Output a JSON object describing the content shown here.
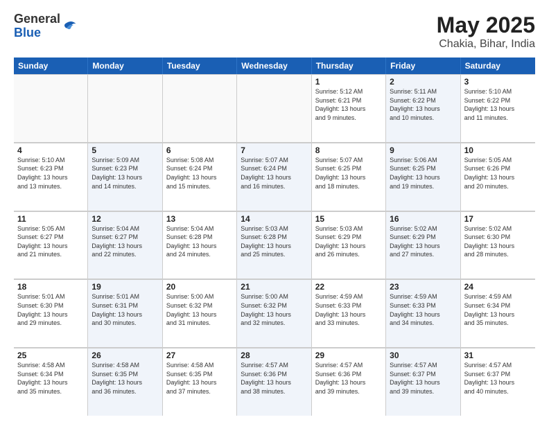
{
  "logo": {
    "general": "General",
    "blue": "Blue"
  },
  "title": "May 2025",
  "subtitle": "Chakia, Bihar, India",
  "header_days": [
    "Sunday",
    "Monday",
    "Tuesday",
    "Wednesday",
    "Thursday",
    "Friday",
    "Saturday"
  ],
  "weeks": [
    [
      {
        "day": "",
        "info": "",
        "shaded": false,
        "empty": true
      },
      {
        "day": "",
        "info": "",
        "shaded": false,
        "empty": true
      },
      {
        "day": "",
        "info": "",
        "shaded": false,
        "empty": true
      },
      {
        "day": "",
        "info": "",
        "shaded": false,
        "empty": true
      },
      {
        "day": "1",
        "info": "Sunrise: 5:12 AM\nSunset: 6:21 PM\nDaylight: 13 hours\nand 9 minutes.",
        "shaded": false,
        "empty": false
      },
      {
        "day": "2",
        "info": "Sunrise: 5:11 AM\nSunset: 6:22 PM\nDaylight: 13 hours\nand 10 minutes.",
        "shaded": true,
        "empty": false
      },
      {
        "day": "3",
        "info": "Sunrise: 5:10 AM\nSunset: 6:22 PM\nDaylight: 13 hours\nand 11 minutes.",
        "shaded": false,
        "empty": false
      }
    ],
    [
      {
        "day": "4",
        "info": "Sunrise: 5:10 AM\nSunset: 6:23 PM\nDaylight: 13 hours\nand 13 minutes.",
        "shaded": false,
        "empty": false
      },
      {
        "day": "5",
        "info": "Sunrise: 5:09 AM\nSunset: 6:23 PM\nDaylight: 13 hours\nand 14 minutes.",
        "shaded": true,
        "empty": false
      },
      {
        "day": "6",
        "info": "Sunrise: 5:08 AM\nSunset: 6:24 PM\nDaylight: 13 hours\nand 15 minutes.",
        "shaded": false,
        "empty": false
      },
      {
        "day": "7",
        "info": "Sunrise: 5:07 AM\nSunset: 6:24 PM\nDaylight: 13 hours\nand 16 minutes.",
        "shaded": true,
        "empty": false
      },
      {
        "day": "8",
        "info": "Sunrise: 5:07 AM\nSunset: 6:25 PM\nDaylight: 13 hours\nand 18 minutes.",
        "shaded": false,
        "empty": false
      },
      {
        "day": "9",
        "info": "Sunrise: 5:06 AM\nSunset: 6:25 PM\nDaylight: 13 hours\nand 19 minutes.",
        "shaded": true,
        "empty": false
      },
      {
        "day": "10",
        "info": "Sunrise: 5:05 AM\nSunset: 6:26 PM\nDaylight: 13 hours\nand 20 minutes.",
        "shaded": false,
        "empty": false
      }
    ],
    [
      {
        "day": "11",
        "info": "Sunrise: 5:05 AM\nSunset: 6:27 PM\nDaylight: 13 hours\nand 21 minutes.",
        "shaded": false,
        "empty": false
      },
      {
        "day": "12",
        "info": "Sunrise: 5:04 AM\nSunset: 6:27 PM\nDaylight: 13 hours\nand 22 minutes.",
        "shaded": true,
        "empty": false
      },
      {
        "day": "13",
        "info": "Sunrise: 5:04 AM\nSunset: 6:28 PM\nDaylight: 13 hours\nand 24 minutes.",
        "shaded": false,
        "empty": false
      },
      {
        "day": "14",
        "info": "Sunrise: 5:03 AM\nSunset: 6:28 PM\nDaylight: 13 hours\nand 25 minutes.",
        "shaded": true,
        "empty": false
      },
      {
        "day": "15",
        "info": "Sunrise: 5:03 AM\nSunset: 6:29 PM\nDaylight: 13 hours\nand 26 minutes.",
        "shaded": false,
        "empty": false
      },
      {
        "day": "16",
        "info": "Sunrise: 5:02 AM\nSunset: 6:29 PM\nDaylight: 13 hours\nand 27 minutes.",
        "shaded": true,
        "empty": false
      },
      {
        "day": "17",
        "info": "Sunrise: 5:02 AM\nSunset: 6:30 PM\nDaylight: 13 hours\nand 28 minutes.",
        "shaded": false,
        "empty": false
      }
    ],
    [
      {
        "day": "18",
        "info": "Sunrise: 5:01 AM\nSunset: 6:30 PM\nDaylight: 13 hours\nand 29 minutes.",
        "shaded": false,
        "empty": false
      },
      {
        "day": "19",
        "info": "Sunrise: 5:01 AM\nSunset: 6:31 PM\nDaylight: 13 hours\nand 30 minutes.",
        "shaded": true,
        "empty": false
      },
      {
        "day": "20",
        "info": "Sunrise: 5:00 AM\nSunset: 6:32 PM\nDaylight: 13 hours\nand 31 minutes.",
        "shaded": false,
        "empty": false
      },
      {
        "day": "21",
        "info": "Sunrise: 5:00 AM\nSunset: 6:32 PM\nDaylight: 13 hours\nand 32 minutes.",
        "shaded": true,
        "empty": false
      },
      {
        "day": "22",
        "info": "Sunrise: 4:59 AM\nSunset: 6:33 PM\nDaylight: 13 hours\nand 33 minutes.",
        "shaded": false,
        "empty": false
      },
      {
        "day": "23",
        "info": "Sunrise: 4:59 AM\nSunset: 6:33 PM\nDaylight: 13 hours\nand 34 minutes.",
        "shaded": true,
        "empty": false
      },
      {
        "day": "24",
        "info": "Sunrise: 4:59 AM\nSunset: 6:34 PM\nDaylight: 13 hours\nand 35 minutes.",
        "shaded": false,
        "empty": false
      }
    ],
    [
      {
        "day": "25",
        "info": "Sunrise: 4:58 AM\nSunset: 6:34 PM\nDaylight: 13 hours\nand 35 minutes.",
        "shaded": false,
        "empty": false
      },
      {
        "day": "26",
        "info": "Sunrise: 4:58 AM\nSunset: 6:35 PM\nDaylight: 13 hours\nand 36 minutes.",
        "shaded": true,
        "empty": false
      },
      {
        "day": "27",
        "info": "Sunrise: 4:58 AM\nSunset: 6:35 PM\nDaylight: 13 hours\nand 37 minutes.",
        "shaded": false,
        "empty": false
      },
      {
        "day": "28",
        "info": "Sunrise: 4:57 AM\nSunset: 6:36 PM\nDaylight: 13 hours\nand 38 minutes.",
        "shaded": true,
        "empty": false
      },
      {
        "day": "29",
        "info": "Sunrise: 4:57 AM\nSunset: 6:36 PM\nDaylight: 13 hours\nand 39 minutes.",
        "shaded": false,
        "empty": false
      },
      {
        "day": "30",
        "info": "Sunrise: 4:57 AM\nSunset: 6:37 PM\nDaylight: 13 hours\nand 39 minutes.",
        "shaded": true,
        "empty": false
      },
      {
        "day": "31",
        "info": "Sunrise: 4:57 AM\nSunset: 6:37 PM\nDaylight: 13 hours\nand 40 minutes.",
        "shaded": false,
        "empty": false
      }
    ]
  ]
}
